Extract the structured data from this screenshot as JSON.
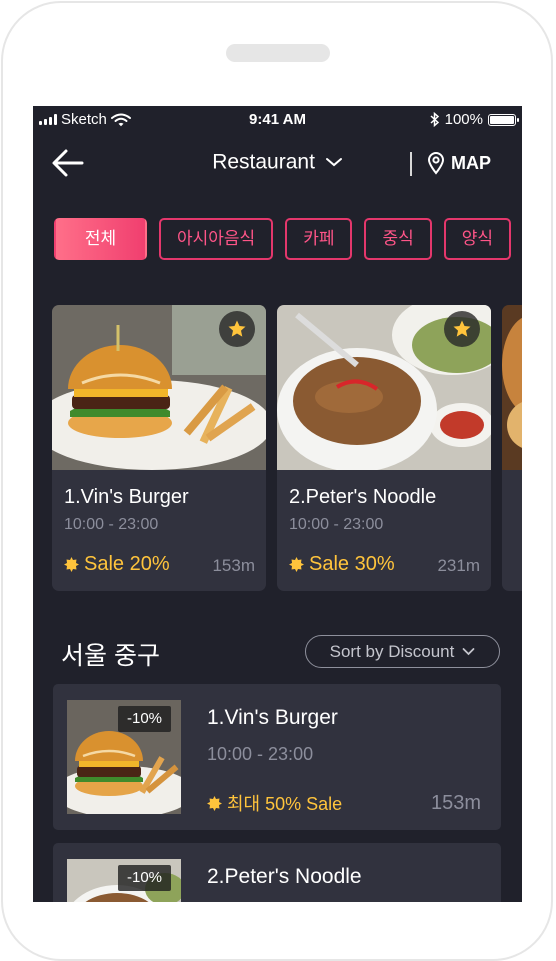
{
  "status_bar": {
    "carrier": "Sketch",
    "time": "9:41 AM",
    "battery": "100%"
  },
  "navbar": {
    "title": "Restaurant",
    "map_label": "MAP"
  },
  "categories": [
    {
      "label": "전체",
      "active": true
    },
    {
      "label": "아시아음식",
      "active": false
    },
    {
      "label": "카페",
      "active": false
    },
    {
      "label": "중식",
      "active": false
    },
    {
      "label": "양식",
      "active": false
    }
  ],
  "featured": [
    {
      "name": "1.Vin's Burger",
      "hours": "10:00 - 23:00",
      "sale": "Sale 20%",
      "distance": "153m",
      "image": "burger"
    },
    {
      "name": "2.Peter's Noodle",
      "hours": "10:00 - 23:00",
      "sale": "Sale 30%",
      "distance": "231m",
      "image": "noodle"
    }
  ],
  "section": {
    "title": "서울 중구",
    "sort_label": "Sort by Discount"
  },
  "list": [
    {
      "name": "1.Vin's Burger",
      "hours": "10:00 - 23:00",
      "sale": "최대 50% Sale",
      "distance": "153m",
      "discount": "-10%",
      "image": "burger"
    },
    {
      "name": "2.Peter's Noodle",
      "hours": "",
      "sale": "",
      "distance": "",
      "discount": "-10%",
      "image": "noodle"
    }
  ],
  "colors": {
    "background": "#20212b",
    "card": "#31323e",
    "accent": "#f03f6f",
    "sale": "#ffc43c"
  }
}
